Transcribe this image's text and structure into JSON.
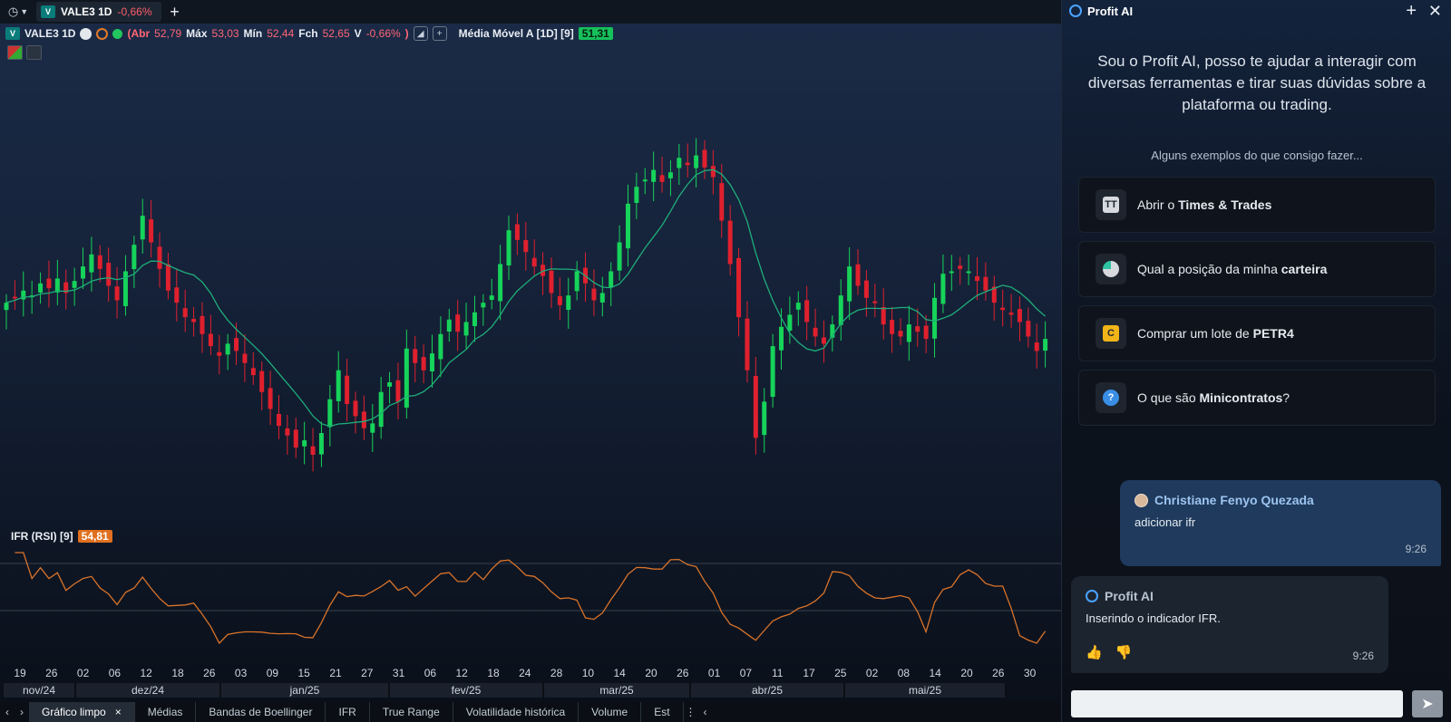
{
  "tabbar": {
    "tab_symbol": "VALE3 1D",
    "tab_change": "-0,66%",
    "add_tab": "+"
  },
  "chart_header": {
    "symbol": "VALE3 1D",
    "abr_label": "(Abr",
    "abr_value": "52,79",
    "max_label": "Máx",
    "max_value": "53,03",
    "min_label": "Mín",
    "min_value": "52,44",
    "fch_label": "Fch",
    "fch_value": "52,65",
    "var_label": "V",
    "var_value": "-0,66%",
    "close_paren": ")",
    "ma_label": "Média Móvel A [1D] [9]",
    "ma_value": "51,31"
  },
  "rsi": {
    "label": "IFR (RSI) [9]",
    "value": "54,81"
  },
  "colors": {
    "up": "#16d35a",
    "down": "#e0202e",
    "ma": "#1fae7a",
    "rsi": "#d9732a",
    "accent": "#4aa3ff"
  },
  "chart_data": {
    "type": "candlestick",
    "series_note": "VALE3 daily candles with 9-period moving average and RSI(9)",
    "closes": [
      52.6,
      52.8,
      53.1,
      52.9,
      53.4,
      53.2,
      53.6,
      53.0,
      53.5,
      54.1,
      54.6,
      54.0,
      53.3,
      52.7,
      53.9,
      55.0,
      56.2,
      55.1,
      54.0,
      53.1,
      52.6,
      52.0,
      51.8,
      51.3,
      50.8,
      50.4,
      50.9,
      50.6,
      50.1,
      49.6,
      48.9,
      48.2,
      47.5,
      47.1,
      46.6,
      46.9,
      46.3,
      47.2,
      48.6,
      49.8,
      48.4,
      47.9,
      47.4,
      47.6,
      48.9,
      49.3,
      48.5,
      50.7,
      50.1,
      49.8,
      50.5,
      51.3,
      51.9,
      51.4,
      51.8,
      52.2,
      52.6,
      52.9,
      54.2,
      55.6,
      55.2,
      54.7,
      54.1,
      53.7,
      53.0,
      52.5,
      52.9,
      53.9,
      53.4,
      52.7,
      53.0,
      53.9,
      55.1,
      56.7,
      57.4,
      57.7,
      58.1,
      57.6,
      58.0,
      58.6,
      58.3,
      58.7,
      58.2,
      57.8,
      56.0,
      54.2,
      52.0,
      49.8,
      47.0,
      48.5,
      50.8,
      51.6,
      52.1,
      52.6,
      51.8,
      51.2,
      50.9,
      51.7,
      52.9,
      54.1,
      53.3,
      52.8,
      52.6,
      51.7,
      51.3,
      51.2,
      51.7,
      51.4,
      51.1,
      52.8,
      53.8,
      53.9,
      54.0,
      53.9,
      53.5,
      53.1,
      52.6,
      52.3,
      52.1,
      51.8,
      51.2,
      50.6,
      51.1
    ],
    "ma9_last": 51.31,
    "rsi_last": 54.81,
    "x_tick_labels": [
      "19",
      "26",
      "02",
      "06",
      "12",
      "18",
      "26",
      "03",
      "09",
      "15",
      "21",
      "27",
      "31",
      "06",
      "12",
      "18",
      "24",
      "28",
      "10",
      "14",
      "20",
      "26",
      "01",
      "07",
      "11",
      "17",
      "25",
      "02",
      "08",
      "14",
      "20",
      "26",
      "30"
    ],
    "month_labels": [
      "nov/24",
      "dez/24",
      "jan/25",
      "fev/25",
      "mar/25",
      "abr/25",
      "mai/25"
    ]
  },
  "bottom_tabs": [
    "Gráfico limpo",
    "Médias",
    "Bandas de Boellinger",
    "IFR",
    "True Range",
    "Volatilidade histórica",
    "Volume",
    "Est"
  ],
  "ai_panel": {
    "title": "Profit AI",
    "intro": "Sou o Profit AI, posso te ajudar a interagir com diversas ferramentas e tirar suas dúvidas sobre a plataforma ou trading.",
    "examples_title": "Alguns exemplos do que consigo fazer...",
    "examples": [
      {
        "pre": "Abrir o ",
        "bold": "Times & Trades",
        "post": "",
        "icon": "TT"
      },
      {
        "pre": "Qual a posição da minha ",
        "bold": "carteira",
        "post": "",
        "icon": ""
      },
      {
        "pre": "Comprar um lote de ",
        "bold": "PETR4",
        "post": "",
        "icon": "C"
      },
      {
        "pre": "O que são ",
        "bold": "Minicontratos",
        "post": "?",
        "icon": "?"
      }
    ],
    "user_message": {
      "author": "Christiane Fenyo Quezada",
      "text": "adicionar ifr",
      "time": "9:26"
    },
    "ai_message": {
      "author": "Profit AI",
      "text": "Inserindo o indicador IFR.",
      "time": "9:26"
    }
  }
}
